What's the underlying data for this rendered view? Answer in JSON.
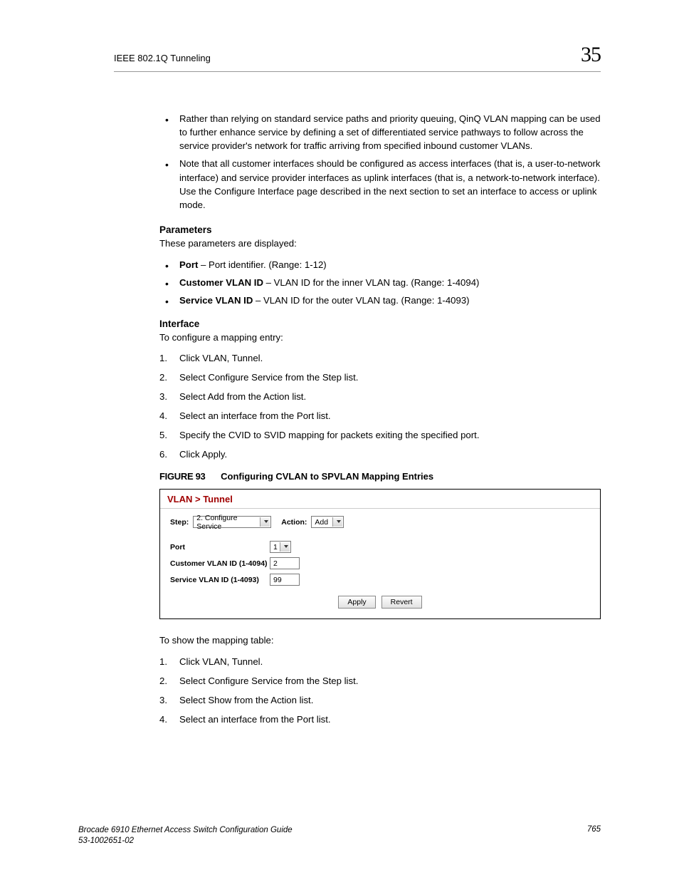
{
  "header": {
    "title": "IEEE 802.1Q Tunneling",
    "chapter": "35"
  },
  "bullets_intro": [
    "Rather than relying on standard service paths and priority queuing, QinQ VLAN mapping can be used to further enhance service by defining a set of differentiated service pathways to follow across the service provider's network for traffic arriving from specified inbound customer VLANs.",
    "Note that all customer interfaces should be configured as access interfaces (that is, a user-to-network interface) and service provider interfaces as uplink interfaces (that is, a network-to-network interface). Use the Configure Interface page described in the next section to set an interface to access or uplink mode."
  ],
  "params_head": "Parameters",
  "params_intro": "These parameters are displayed:",
  "params": [
    {
      "name": "Port",
      "desc": " – Port identifier. (Range: 1-12)"
    },
    {
      "name": "Customer VLAN ID",
      "desc": " – VLAN ID for the inner VLAN tag. (Range: 1-4094)"
    },
    {
      "name": "Service VLAN ID",
      "desc": " – VLAN ID for the outer VLAN tag. (Range: 1-4093)"
    }
  ],
  "iface_head": "Interface",
  "iface_intro": "To configure a mapping entry:",
  "steps1": [
    "Click VLAN, Tunnel.",
    "Select Configure Service from the Step list.",
    "Select Add from the Action list.",
    "Select an interface from the Port list.",
    "Specify the CVID to SVID mapping for packets exiting the specified port.",
    "Click Apply."
  ],
  "figure": {
    "label": "FIGURE 93",
    "title": "Configuring CVLAN to SPVLAN Mapping Entries",
    "breadcrumb": "VLAN > Tunnel",
    "step_label": "Step:",
    "step_select": "2. Configure Service",
    "action_label": "Action:",
    "action_select": "Add",
    "port_label": "Port",
    "port_select": "1",
    "cvlan_label": "Customer VLAN ID (1-4094)",
    "cvlan_value": "2",
    "svlan_label": "Service VLAN ID (1-4093)",
    "svlan_value": "99",
    "apply": "Apply",
    "revert": "Revert"
  },
  "show_intro": "To show the mapping table:",
  "steps2": [
    "Click VLAN, Tunnel.",
    "Select Configure Service from the Step list.",
    "Select Show from the Action list.",
    "Select an interface from the Port list."
  ],
  "footer": {
    "doc1": "Brocade 6910 Ethernet Access Switch Configuration Guide",
    "doc2": "53-1002651-02",
    "page": "765"
  }
}
